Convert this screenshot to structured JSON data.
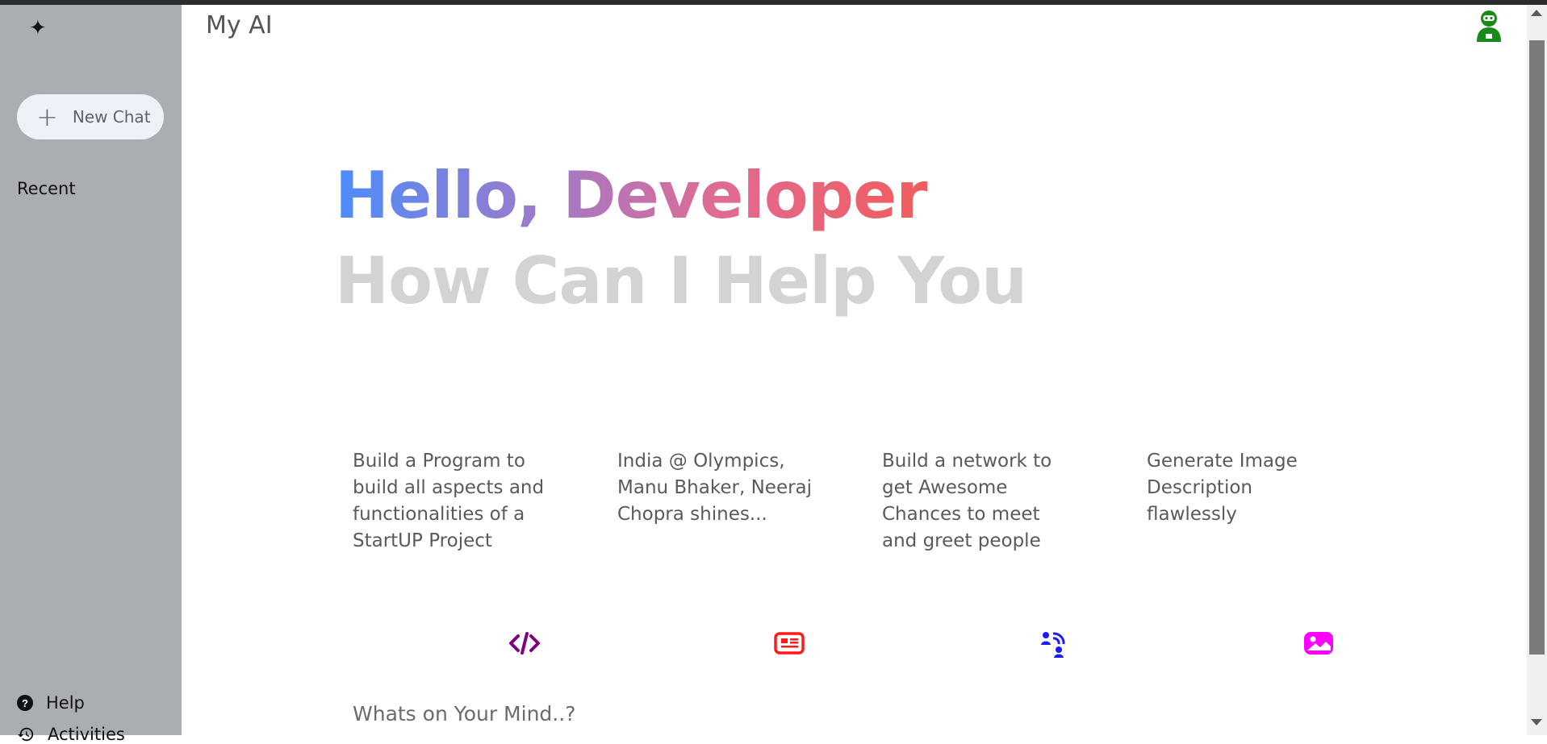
{
  "app": {
    "title": "My AI"
  },
  "sidebar": {
    "new_chat_label": "New Chat",
    "recent_label": "Recent",
    "bottom_items": [
      {
        "label": "Help",
        "icon": "question-icon"
      },
      {
        "label": "Activities",
        "icon": "history-icon"
      }
    ]
  },
  "greeting": {
    "hello": "Hello, Developer",
    "subtitle": "How Can I Help You",
    "gradient_colors": [
      "#4b8dfb",
      "#9f7ac9",
      "#e06b92",
      "#f25c5c"
    ]
  },
  "cards": [
    {
      "text": "Build a Program to build all aspects and functionalities of a StartUP Project",
      "icon": "code-icon",
      "icon_color": "#800080"
    },
    {
      "text": "India @ Olympics, Manu Bhaker, Neeraj Chopra shines...",
      "icon": "news-icon",
      "icon_color": "#ff1a1a"
    },
    {
      "text": "Build a network to get Awesome Chances to meet and greet people",
      "icon": "network-icon",
      "icon_color": "#1a1aff"
    },
    {
      "text": "Generate Image Description flawlessly",
      "icon": "image-icon",
      "icon_color": "#ff00ff"
    }
  ],
  "prompt": {
    "placeholder": "Whats on Your Mind..?"
  },
  "colors": {
    "sidebar_bg": "#aaadb2",
    "avatar_color": "#1a8a1a"
  }
}
